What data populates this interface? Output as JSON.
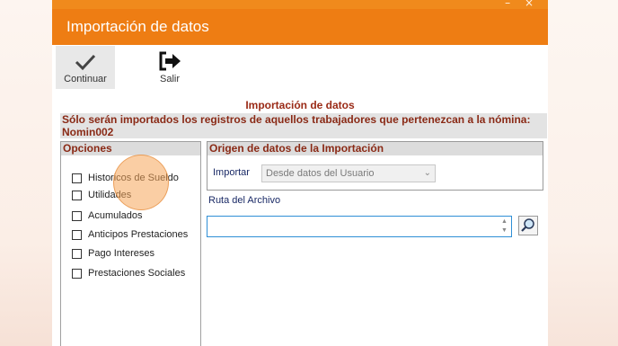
{
  "window": {
    "title": "Importación de datos",
    "controls": "– ×"
  },
  "toolbar": {
    "continuar_label": "Continuar",
    "salir_label": "Salir"
  },
  "section_title": "Importación de datos",
  "notice": "Sólo serán importados los registros de aquellos trabajadores que pertenezcan a la nómina: Nomin002",
  "opciones": {
    "header": "Opciones",
    "items": [
      {
        "label": "Historicos de Sueldo",
        "checked": false
      },
      {
        "label": "Utilidades",
        "checked": false
      },
      {
        "label": "Acumulados",
        "checked": false
      },
      {
        "label": "Anticipos Prestaciones",
        "checked": false
      },
      {
        "label": "Pago Intereses",
        "checked": false
      },
      {
        "label": "Prestaciones Sociales",
        "checked": false
      }
    ]
  },
  "origen": {
    "header": "Origen de datos de la Importación",
    "importar_label": "Importar",
    "importar_value": "Desde datos del Usuario"
  },
  "ruta": {
    "label": "Ruta del Archivo",
    "value": ""
  },
  "colors": {
    "accent": "#ee7d13",
    "header_text": "#8a2a16",
    "label_text": "#1a2a66",
    "input_focus": "#2f8fd6"
  },
  "icons": {
    "continuar": "checkmark-icon",
    "salir": "exit-icon",
    "browse": "search-icon"
  }
}
